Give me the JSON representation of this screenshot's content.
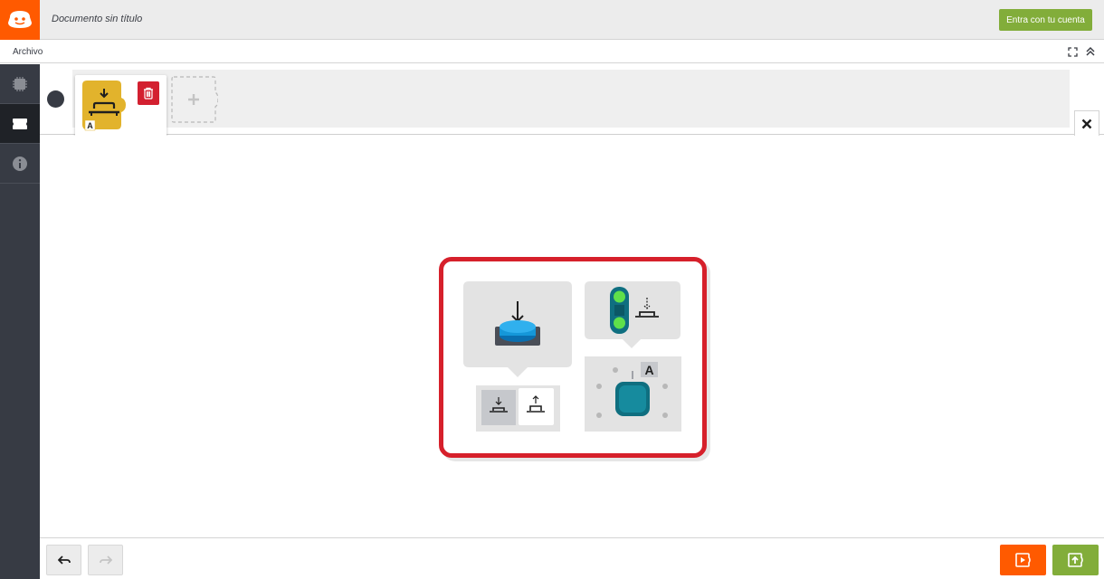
{
  "header": {
    "document_title": "Documento sin título",
    "login_label": "Entra con tu cuenta"
  },
  "menubar": {
    "file_menu": "Archivo"
  },
  "blockbar": {
    "port_label": "A"
  },
  "hint": {
    "port_label": "A"
  },
  "colors": {
    "brand_orange": "#ff5a00",
    "accent_green": "#82ad3a",
    "sidebar_dark": "#373b44",
    "block_yellow": "#e2b32c",
    "trash_red": "#d32030",
    "highlight_red": "#d6202b"
  },
  "icons": {
    "logo": "robot-logo-icon",
    "fullscreen": "fullscreen-icon",
    "collapse": "double-chevron-up-icon",
    "hardware": "chip-icon",
    "blocks": "block-piece-icon",
    "info": "info-icon",
    "trash": "trash-icon",
    "add": "plus-icon",
    "close": "close-icon",
    "undo": "undo-icon",
    "redo": "redo-icon",
    "simulate": "play-icon",
    "upload": "upload-icon"
  }
}
